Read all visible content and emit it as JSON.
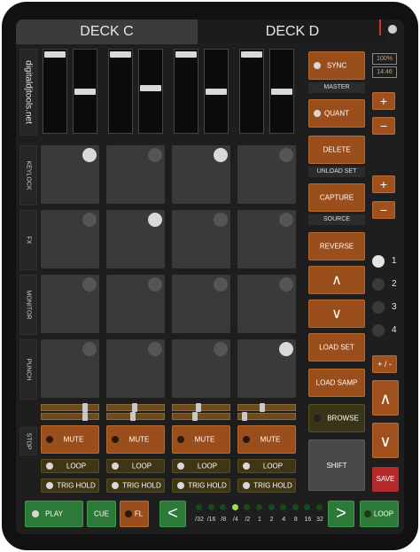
{
  "decks": {
    "left_tab": "DECK C",
    "right_tab": "DECK D"
  },
  "site_label": "digitaldjtools.net",
  "row_labels": [
    "KEYLOCK",
    "FX",
    "MONITOR",
    "PUNCH",
    "STOP"
  ],
  "faders": [
    {
      "level": 1.0
    },
    {
      "level": 0.5
    },
    {
      "level": 1.0
    },
    {
      "level": 0.55
    },
    {
      "level": 1.0
    },
    {
      "level": 0.5
    },
    {
      "level": 1.0
    },
    {
      "level": 0.5
    }
  ],
  "pads": [
    [
      true,
      false,
      true,
      false
    ],
    [
      false,
      true,
      false,
      false
    ],
    [
      false,
      false,
      false,
      false
    ],
    [
      false,
      false,
      false,
      true
    ]
  ],
  "channel_buttons": {
    "mute": "MUTE",
    "loop": "LOOP",
    "trig_hold": "TRIG HOLD"
  },
  "right_column": {
    "sync": "SYNC",
    "master": "MASTER",
    "quant": "QUANT",
    "delete": "DELETE",
    "unload_set": "UNLOAD SET",
    "capture": "CAPTURE",
    "source": "SOURCE",
    "reverse": "REVERSE",
    "up": "∧",
    "down": "∨",
    "load_set": "LOAD SET",
    "load_samp": "LOAD SAMP",
    "browse": "BROWSE",
    "shift": "SHIFT"
  },
  "status": {
    "battery": "100%",
    "time": "14:46"
  },
  "far_right": {
    "plus": "+",
    "minus": "−",
    "plus_minus": "+ / -",
    "up": "∧",
    "down": "∨",
    "save": "SAVE",
    "deck_numbers": [
      "1",
      "2",
      "3",
      "4"
    ],
    "active_deck": "1"
  },
  "transport": {
    "play": "PLAY",
    "cue": "CUE",
    "fl": "FL",
    "prev": "<",
    "next": ">",
    "loop": "LOOP",
    "beat_labels": [
      "/32",
      "/16",
      "/8",
      "/4",
      "/2",
      "1",
      "2",
      "4",
      "8",
      "16",
      "32"
    ],
    "active_beat_index": 3
  },
  "colors": {
    "orange": "#9a4e1c",
    "green": "#2d7a38",
    "red": "#b52a2a"
  }
}
